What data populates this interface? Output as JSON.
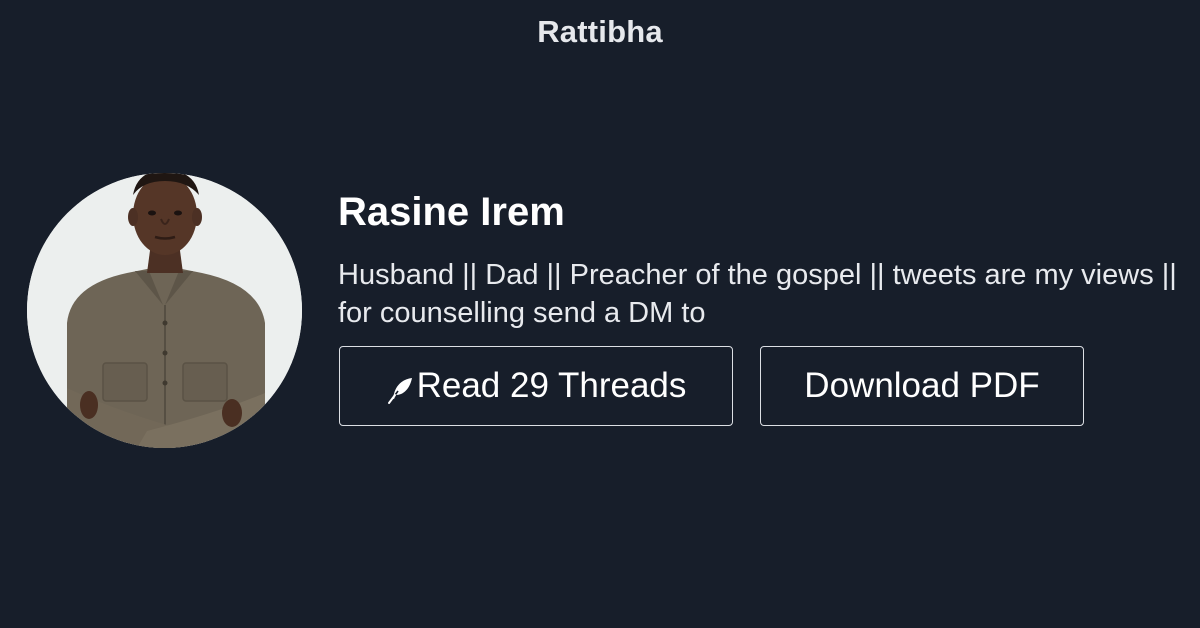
{
  "header": {
    "brand": "Rattibha"
  },
  "profile": {
    "name": "Rasine Irem",
    "bio": "Husband || Dad || Preacher of the gospel || tweets are my views || for counselling send a DM to",
    "avatar_icon": "profile-photo"
  },
  "actions": {
    "read_label": "Read 29 Threads",
    "read_icon": "feather-icon",
    "pdf_label": "Download PDF"
  },
  "colors": {
    "background": "#171e2a",
    "text": "#ffffff",
    "button_border": "#dcdfe4"
  }
}
